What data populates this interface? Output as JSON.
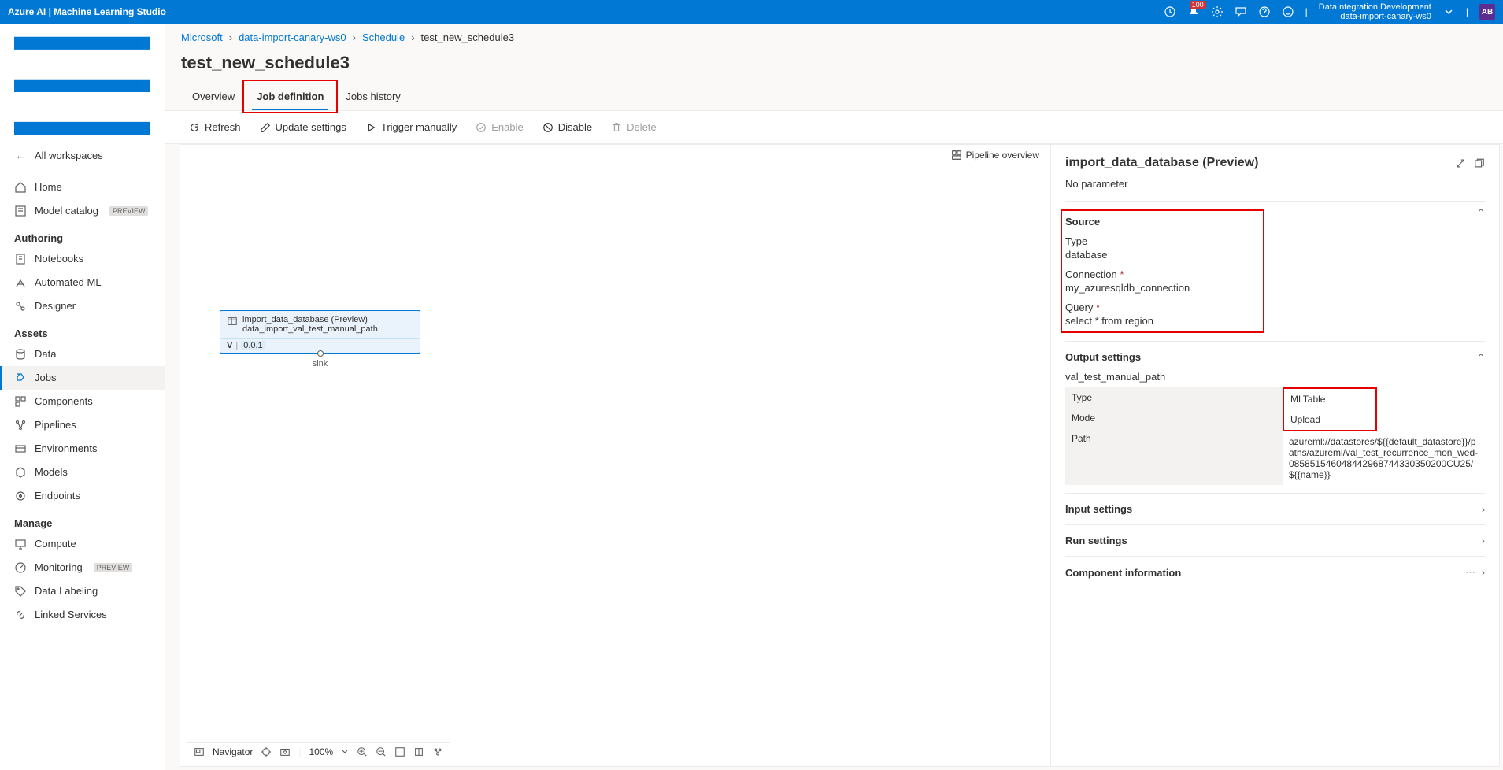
{
  "topbar": {
    "product": "Azure AI | Machine Learning Studio",
    "notif_count": "100",
    "workspace_org": "DataIntegration Development",
    "workspace_name": "data-import-canary-ws0",
    "avatar": "AB"
  },
  "sidebar": {
    "all_workspaces": "All workspaces",
    "home": "Home",
    "model_catalog": "Model catalog",
    "preview_label": "PREVIEW",
    "section_authoring": "Authoring",
    "notebooks": "Notebooks",
    "automated_ml": "Automated ML",
    "designer": "Designer",
    "section_assets": "Assets",
    "data": "Data",
    "jobs": "Jobs",
    "components": "Components",
    "pipelines": "Pipelines",
    "environments": "Environments",
    "models": "Models",
    "endpoints": "Endpoints",
    "section_manage": "Manage",
    "compute": "Compute",
    "monitoring": "Monitoring",
    "data_labeling": "Data Labeling",
    "linked_services": "Linked Services"
  },
  "breadcrumb": {
    "b1": "Microsoft",
    "b2": "data-import-canary-ws0",
    "b3": "Schedule",
    "current": "test_new_schedule3"
  },
  "page_title": "test_new_schedule3",
  "tabs": {
    "overview": "Overview",
    "job_def": "Job definition",
    "jobs_history": "Jobs history"
  },
  "toolbar": {
    "refresh": "Refresh",
    "update": "Update settings",
    "trigger": "Trigger manually",
    "enable": "Enable",
    "disable": "Disable",
    "delete": "Delete"
  },
  "pipeline_overview": "Pipeline overview",
  "node": {
    "title": "import_data_database (Preview)",
    "subtitle": "data_import_val_test_manual_path",
    "version_prefix": "V",
    "version": "0.0.1",
    "port_label": "sink"
  },
  "canvas_footer": {
    "navigator": "Navigator",
    "zoom": "100%"
  },
  "details": {
    "title": "import_data_database (Preview)",
    "no_param": "No parameter",
    "source": {
      "heading": "Source",
      "type_label": "Type",
      "type_value": "database",
      "conn_label": "Connection",
      "conn_value": "my_azuresqldb_connection",
      "query_label": "Query",
      "query_value": "select * from region"
    },
    "output": {
      "heading": "Output settings",
      "subtitle": "val_test_manual_path",
      "type_label": "Type",
      "type_value": "MLTable",
      "mode_label": "Mode",
      "mode_value": "Upload",
      "path_label": "Path",
      "path_value": "azureml://datastores/${{default_datastore}}/paths/azureml/val_test_recurrence_mon_wed-085851546048442968744330350200CU25/${{name}}"
    },
    "input_settings": "Input settings",
    "run_settings": "Run settings",
    "component_info": "Component information"
  }
}
